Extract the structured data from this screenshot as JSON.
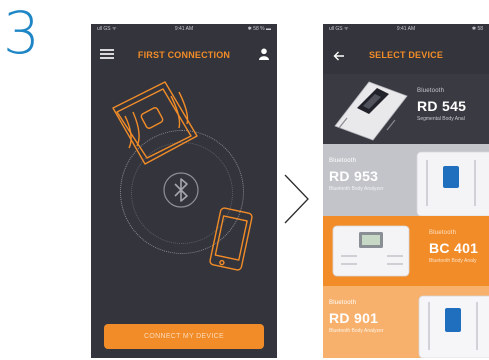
{
  "step": {
    "number": "3"
  },
  "screen1": {
    "status": {
      "left": "ull GS ᯤ",
      "time": "9:41 AM",
      "right": "✱ 58 % ▬"
    },
    "title": "FIRST CONNECTION",
    "connect_label": "CONNECT MY DEVICE"
  },
  "screen2": {
    "status": {
      "left": "ull GS ᯤ",
      "time": "9:41 AM",
      "right": "✱ 58"
    },
    "title": "SELECT DEVICE",
    "devices": [
      {
        "brand": "Bluetooth",
        "model": "RD 545",
        "desc": "Segmental Body Anal"
      },
      {
        "brand": "Bluetooth",
        "model": "RD 953",
        "desc": "Bluetooth Body Analyzer"
      },
      {
        "brand": "Bluetooth",
        "model": "BC 401",
        "desc": "Bluetooth Body Analy"
      },
      {
        "brand": "Bluetooth",
        "model": "RD 901",
        "desc": "Bluetooth Body Analyzer"
      }
    ]
  },
  "colors": {
    "accent": "#f28c28",
    "step_blue": "#1f86c6",
    "screen_bg": "#34353c"
  },
  "icons": [
    "hamburger-menu-icon",
    "user-icon",
    "bluetooth-icon",
    "back-arrow-icon",
    "chevron-right-icon"
  ]
}
